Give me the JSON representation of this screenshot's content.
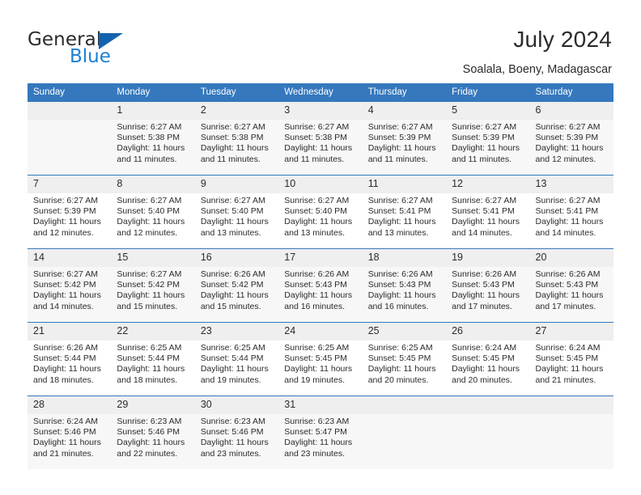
{
  "brand": {
    "name_top": "General",
    "name_bottom": "Blue",
    "accent_color": "#1c7fd4",
    "triangle_color": "#1263ad"
  },
  "header": {
    "title": "July 2024",
    "subtitle": "Soalala, Boeny, Madagascar"
  },
  "calendar": {
    "header_bg": "#3578bd",
    "weekdays": [
      "Sunday",
      "Monday",
      "Tuesday",
      "Wednesday",
      "Thursday",
      "Friday",
      "Saturday"
    ],
    "weeks": [
      [
        {
          "day": "",
          "sunrise": "",
          "sunset": "",
          "daylight_1": "",
          "daylight_2": ""
        },
        {
          "day": "1",
          "sunrise": "Sunrise: 6:27 AM",
          "sunset": "Sunset: 5:38 PM",
          "daylight_1": "Daylight: 11 hours",
          "daylight_2": "and 11 minutes."
        },
        {
          "day": "2",
          "sunrise": "Sunrise: 6:27 AM",
          "sunset": "Sunset: 5:38 PM",
          "daylight_1": "Daylight: 11 hours",
          "daylight_2": "and 11 minutes."
        },
        {
          "day": "3",
          "sunrise": "Sunrise: 6:27 AM",
          "sunset": "Sunset: 5:38 PM",
          "daylight_1": "Daylight: 11 hours",
          "daylight_2": "and 11 minutes."
        },
        {
          "day": "4",
          "sunrise": "Sunrise: 6:27 AM",
          "sunset": "Sunset: 5:39 PM",
          "daylight_1": "Daylight: 11 hours",
          "daylight_2": "and 11 minutes."
        },
        {
          "day": "5",
          "sunrise": "Sunrise: 6:27 AM",
          "sunset": "Sunset: 5:39 PM",
          "daylight_1": "Daylight: 11 hours",
          "daylight_2": "and 11 minutes."
        },
        {
          "day": "6",
          "sunrise": "Sunrise: 6:27 AM",
          "sunset": "Sunset: 5:39 PM",
          "daylight_1": "Daylight: 11 hours",
          "daylight_2": "and 12 minutes."
        }
      ],
      [
        {
          "day": "7",
          "sunrise": "Sunrise: 6:27 AM",
          "sunset": "Sunset: 5:39 PM",
          "daylight_1": "Daylight: 11 hours",
          "daylight_2": "and 12 minutes."
        },
        {
          "day": "8",
          "sunrise": "Sunrise: 6:27 AM",
          "sunset": "Sunset: 5:40 PM",
          "daylight_1": "Daylight: 11 hours",
          "daylight_2": "and 12 minutes."
        },
        {
          "day": "9",
          "sunrise": "Sunrise: 6:27 AM",
          "sunset": "Sunset: 5:40 PM",
          "daylight_1": "Daylight: 11 hours",
          "daylight_2": "and 13 minutes."
        },
        {
          "day": "10",
          "sunrise": "Sunrise: 6:27 AM",
          "sunset": "Sunset: 5:40 PM",
          "daylight_1": "Daylight: 11 hours",
          "daylight_2": "and 13 minutes."
        },
        {
          "day": "11",
          "sunrise": "Sunrise: 6:27 AM",
          "sunset": "Sunset: 5:41 PM",
          "daylight_1": "Daylight: 11 hours",
          "daylight_2": "and 13 minutes."
        },
        {
          "day": "12",
          "sunrise": "Sunrise: 6:27 AM",
          "sunset": "Sunset: 5:41 PM",
          "daylight_1": "Daylight: 11 hours",
          "daylight_2": "and 14 minutes."
        },
        {
          "day": "13",
          "sunrise": "Sunrise: 6:27 AM",
          "sunset": "Sunset: 5:41 PM",
          "daylight_1": "Daylight: 11 hours",
          "daylight_2": "and 14 minutes."
        }
      ],
      [
        {
          "day": "14",
          "sunrise": "Sunrise: 6:27 AM",
          "sunset": "Sunset: 5:42 PM",
          "daylight_1": "Daylight: 11 hours",
          "daylight_2": "and 14 minutes."
        },
        {
          "day": "15",
          "sunrise": "Sunrise: 6:27 AM",
          "sunset": "Sunset: 5:42 PM",
          "daylight_1": "Daylight: 11 hours",
          "daylight_2": "and 15 minutes."
        },
        {
          "day": "16",
          "sunrise": "Sunrise: 6:26 AM",
          "sunset": "Sunset: 5:42 PM",
          "daylight_1": "Daylight: 11 hours",
          "daylight_2": "and 15 minutes."
        },
        {
          "day": "17",
          "sunrise": "Sunrise: 6:26 AM",
          "sunset": "Sunset: 5:43 PM",
          "daylight_1": "Daylight: 11 hours",
          "daylight_2": "and 16 minutes."
        },
        {
          "day": "18",
          "sunrise": "Sunrise: 6:26 AM",
          "sunset": "Sunset: 5:43 PM",
          "daylight_1": "Daylight: 11 hours",
          "daylight_2": "and 16 minutes."
        },
        {
          "day": "19",
          "sunrise": "Sunrise: 6:26 AM",
          "sunset": "Sunset: 5:43 PM",
          "daylight_1": "Daylight: 11 hours",
          "daylight_2": "and 17 minutes."
        },
        {
          "day": "20",
          "sunrise": "Sunrise: 6:26 AM",
          "sunset": "Sunset: 5:43 PM",
          "daylight_1": "Daylight: 11 hours",
          "daylight_2": "and 17 minutes."
        }
      ],
      [
        {
          "day": "21",
          "sunrise": "Sunrise: 6:26 AM",
          "sunset": "Sunset: 5:44 PM",
          "daylight_1": "Daylight: 11 hours",
          "daylight_2": "and 18 minutes."
        },
        {
          "day": "22",
          "sunrise": "Sunrise: 6:25 AM",
          "sunset": "Sunset: 5:44 PM",
          "daylight_1": "Daylight: 11 hours",
          "daylight_2": "and 18 minutes."
        },
        {
          "day": "23",
          "sunrise": "Sunrise: 6:25 AM",
          "sunset": "Sunset: 5:44 PM",
          "daylight_1": "Daylight: 11 hours",
          "daylight_2": "and 19 minutes."
        },
        {
          "day": "24",
          "sunrise": "Sunrise: 6:25 AM",
          "sunset": "Sunset: 5:45 PM",
          "daylight_1": "Daylight: 11 hours",
          "daylight_2": "and 19 minutes."
        },
        {
          "day": "25",
          "sunrise": "Sunrise: 6:25 AM",
          "sunset": "Sunset: 5:45 PM",
          "daylight_1": "Daylight: 11 hours",
          "daylight_2": "and 20 minutes."
        },
        {
          "day": "26",
          "sunrise": "Sunrise: 6:24 AM",
          "sunset": "Sunset: 5:45 PM",
          "daylight_1": "Daylight: 11 hours",
          "daylight_2": "and 20 minutes."
        },
        {
          "day": "27",
          "sunrise": "Sunrise: 6:24 AM",
          "sunset": "Sunset: 5:45 PM",
          "daylight_1": "Daylight: 11 hours",
          "daylight_2": "and 21 minutes."
        }
      ],
      [
        {
          "day": "28",
          "sunrise": "Sunrise: 6:24 AM",
          "sunset": "Sunset: 5:46 PM",
          "daylight_1": "Daylight: 11 hours",
          "daylight_2": "and 21 minutes."
        },
        {
          "day": "29",
          "sunrise": "Sunrise: 6:23 AM",
          "sunset": "Sunset: 5:46 PM",
          "daylight_1": "Daylight: 11 hours",
          "daylight_2": "and 22 minutes."
        },
        {
          "day": "30",
          "sunrise": "Sunrise: 6:23 AM",
          "sunset": "Sunset: 5:46 PM",
          "daylight_1": "Daylight: 11 hours",
          "daylight_2": "and 23 minutes."
        },
        {
          "day": "31",
          "sunrise": "Sunrise: 6:23 AM",
          "sunset": "Sunset: 5:47 PM",
          "daylight_1": "Daylight: 11 hours",
          "daylight_2": "and 23 minutes."
        },
        {
          "day": "",
          "sunrise": "",
          "sunset": "",
          "daylight_1": "",
          "daylight_2": ""
        },
        {
          "day": "",
          "sunrise": "",
          "sunset": "",
          "daylight_1": "",
          "daylight_2": ""
        },
        {
          "day": "",
          "sunrise": "",
          "sunset": "",
          "daylight_1": "",
          "daylight_2": ""
        }
      ]
    ]
  }
}
